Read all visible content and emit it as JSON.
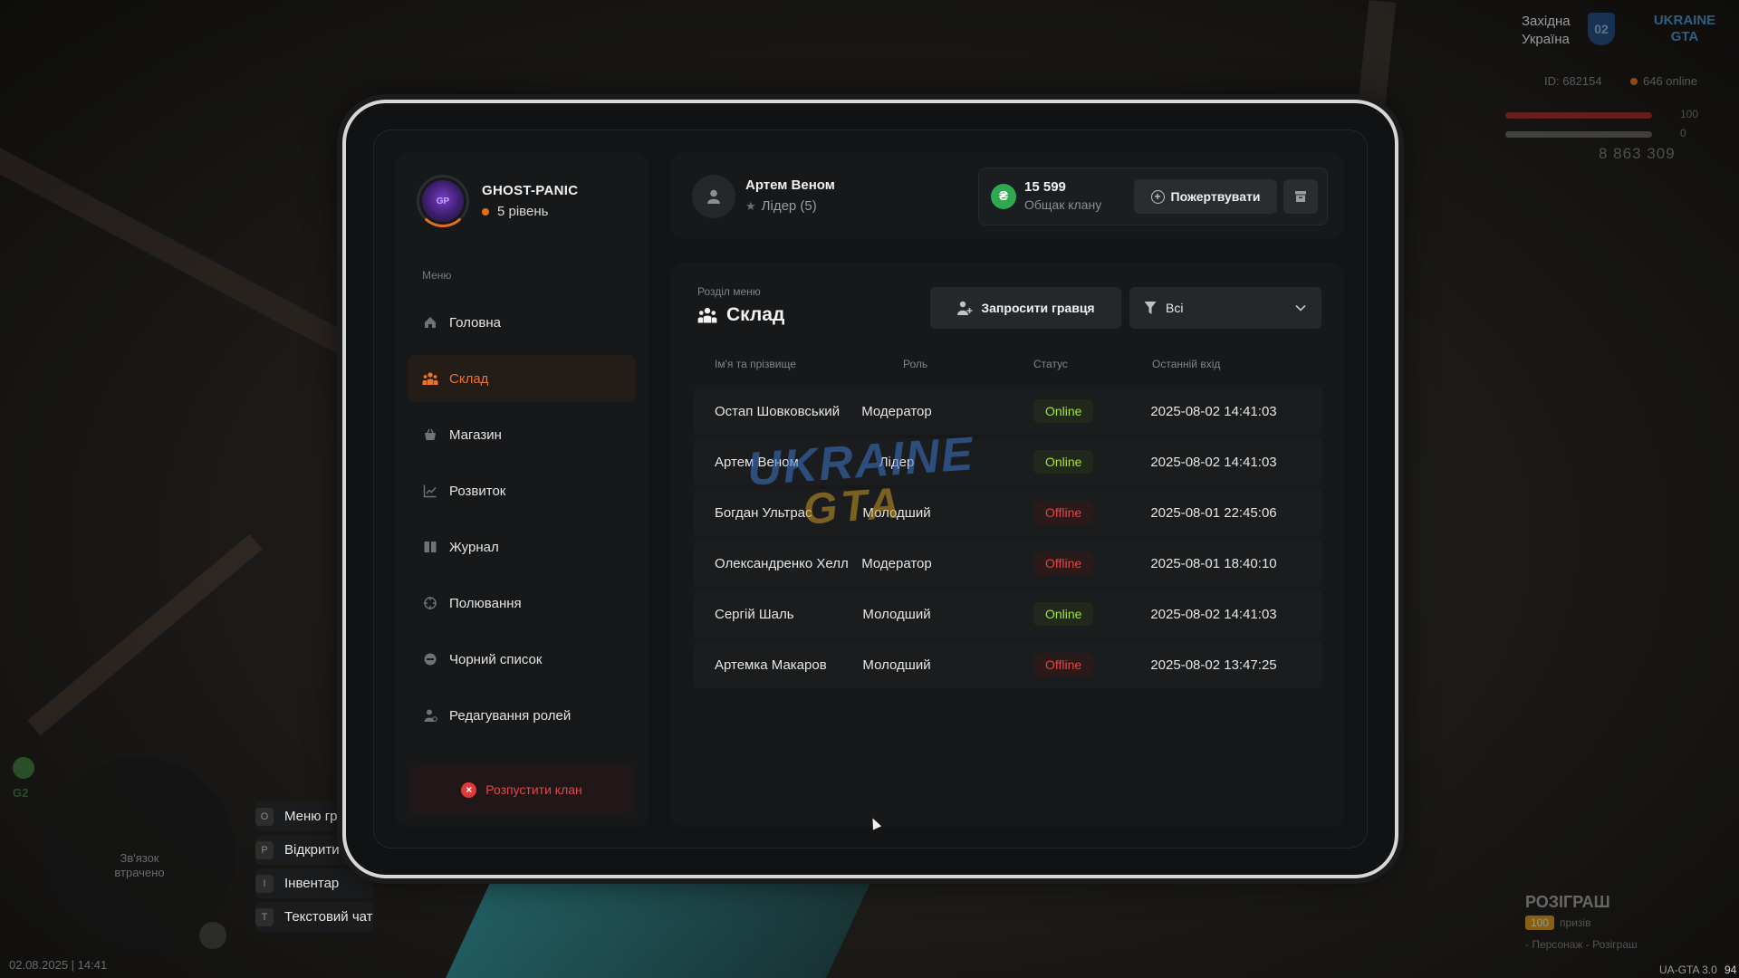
{
  "hud": {
    "region_line1": "Західна",
    "region_line2": "Україна",
    "region_badge": "02",
    "logo_line1": "UKRAINE",
    "logo_line2": "GTA",
    "player_id": "ID: 682154",
    "online": "646 online",
    "health": "100",
    "armor": "0",
    "money": "8 863 309",
    "radar_text_line1": "Зв'язок",
    "radar_text_line2": "втрачено",
    "radar_badge_label": "G2",
    "key_hints": [
      {
        "key": "O",
        "label": "Меню гра..."
      },
      {
        "key": "P",
        "label": "Відкрити ..."
      },
      {
        "key": "I",
        "label": "Інвентар"
      },
      {
        "key": "T",
        "label": "Текстовий чат"
      }
    ],
    "datetime": "02.08.2025 | 14:41",
    "version": "UA-GTA 3.0",
    "fps": "94",
    "giveaway_title": "РОЗІГРАШ",
    "giveaway_tag": "100",
    "giveaway_sub": "призів",
    "giveaway_hint": "- Персонаж - Розіграш"
  },
  "profile": {
    "clan_name": "GHOST-PANIC",
    "level": "5 рівень",
    "avatar_text": "GP"
  },
  "menu": {
    "caption": "Меню",
    "items": [
      {
        "label": "Головна",
        "icon": "home-icon",
        "active": false
      },
      {
        "label": "Склад",
        "icon": "members-icon",
        "active": true
      },
      {
        "label": "Магазин",
        "icon": "shop-icon",
        "active": false
      },
      {
        "label": "Розвиток",
        "icon": "chart-icon",
        "active": false
      },
      {
        "label": "Журнал",
        "icon": "book-icon",
        "active": false
      },
      {
        "label": "Полювання",
        "icon": "crosshair-icon",
        "active": false
      },
      {
        "label": "Чорний список",
        "icon": "block-icon",
        "active": false
      },
      {
        "label": "Редагування ролей",
        "icon": "user-edit-icon",
        "active": false
      }
    ],
    "disband": "Розпустити клан"
  },
  "header": {
    "user_name": "Артем Веном",
    "user_role": "Лідер (5)",
    "money_amount": "15 599",
    "money_caption": "Общак клану",
    "money_icon": "₴",
    "donate": "Пожертвувати"
  },
  "section": {
    "caption": "Розділ меню",
    "title": "Склад",
    "invite": "Запросити гравця",
    "filter_value": "Всі"
  },
  "table": {
    "columns": [
      "Ім'я та прізвище",
      "Роль",
      "Статус",
      "Останній вхід"
    ],
    "rows": [
      {
        "name": "Остап Шовковський",
        "role": "Модератор",
        "status": "Online",
        "last": "2025-08-02 14:41:03"
      },
      {
        "name": "Артем Веном",
        "role": "Лідер",
        "status": "Online",
        "last": "2025-08-02 14:41:03"
      },
      {
        "name": "Богдан Ультрас",
        "role": "Молодший",
        "status": "Offline",
        "last": "2025-08-01 22:45:06"
      },
      {
        "name": "Олександренко Хелл",
        "role": "Модератор",
        "status": "Offline",
        "last": "2025-08-01 18:40:10"
      },
      {
        "name": "Сергій Шаль",
        "role": "Молодший",
        "status": "Online",
        "last": "2025-08-02 14:41:03"
      },
      {
        "name": "Артемка Макаров",
        "role": "Молодший",
        "status": "Offline",
        "last": "2025-08-02 13:47:25"
      }
    ]
  },
  "watermark": {
    "line1": "UKRAINE",
    "line2": "GTA"
  },
  "colors": {
    "accent": "#e0701b",
    "online": "#a7e23a",
    "offline": "#e14848",
    "money": "#2fa84f"
  }
}
